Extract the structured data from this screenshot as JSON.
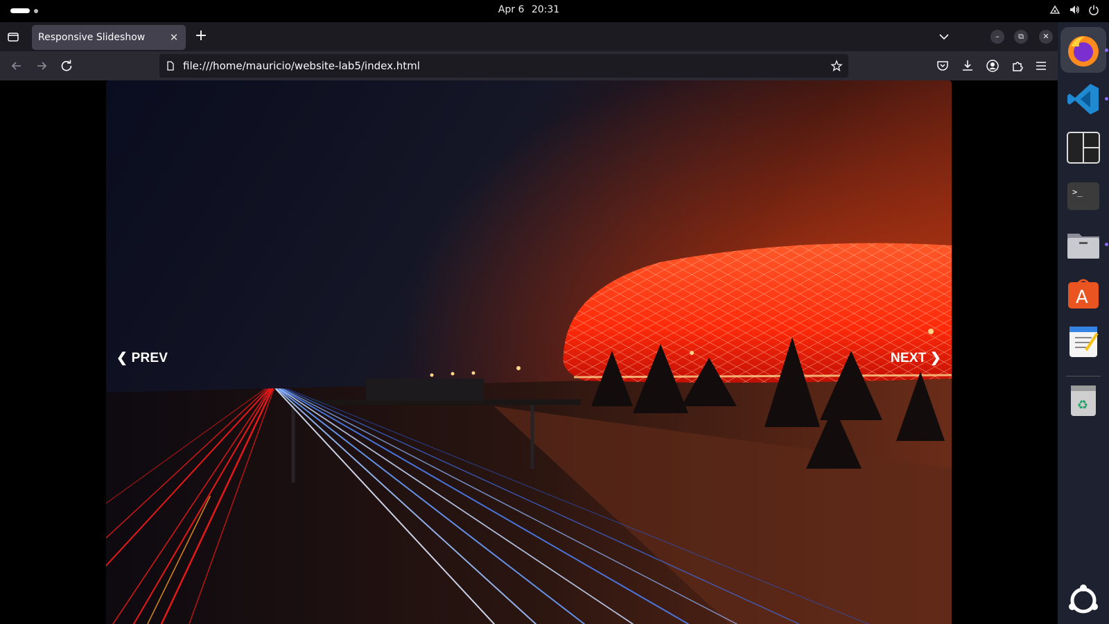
{
  "topbar": {
    "date": "Apr 6",
    "time": "20:31",
    "icons": [
      "network-icon",
      "volume-icon",
      "power-icon"
    ]
  },
  "browser": {
    "tab": {
      "title": "Responsive Slideshow"
    },
    "url": "file:///home/mauricio/website-lab5/index.html"
  },
  "slideshow": {
    "prev_label": "❮ PREV",
    "next_label": "NEXT ❯",
    "image_subject": "stadium-at-night-with-highway-light-trails"
  },
  "dock": {
    "apps": [
      "firefox-icon",
      "vscode-icon",
      "terminator-icon",
      "terminal-icon",
      "files-icon",
      "app-center-icon",
      "text-editor-icon",
      "trash-icon",
      "show-apps-icon"
    ]
  },
  "colors": {
    "tabstrip": "#1c1b22",
    "navbar": "#2b2a33",
    "tab_active": "#42414d",
    "dock": "#1e2230",
    "stadium": "#ff3a14"
  }
}
